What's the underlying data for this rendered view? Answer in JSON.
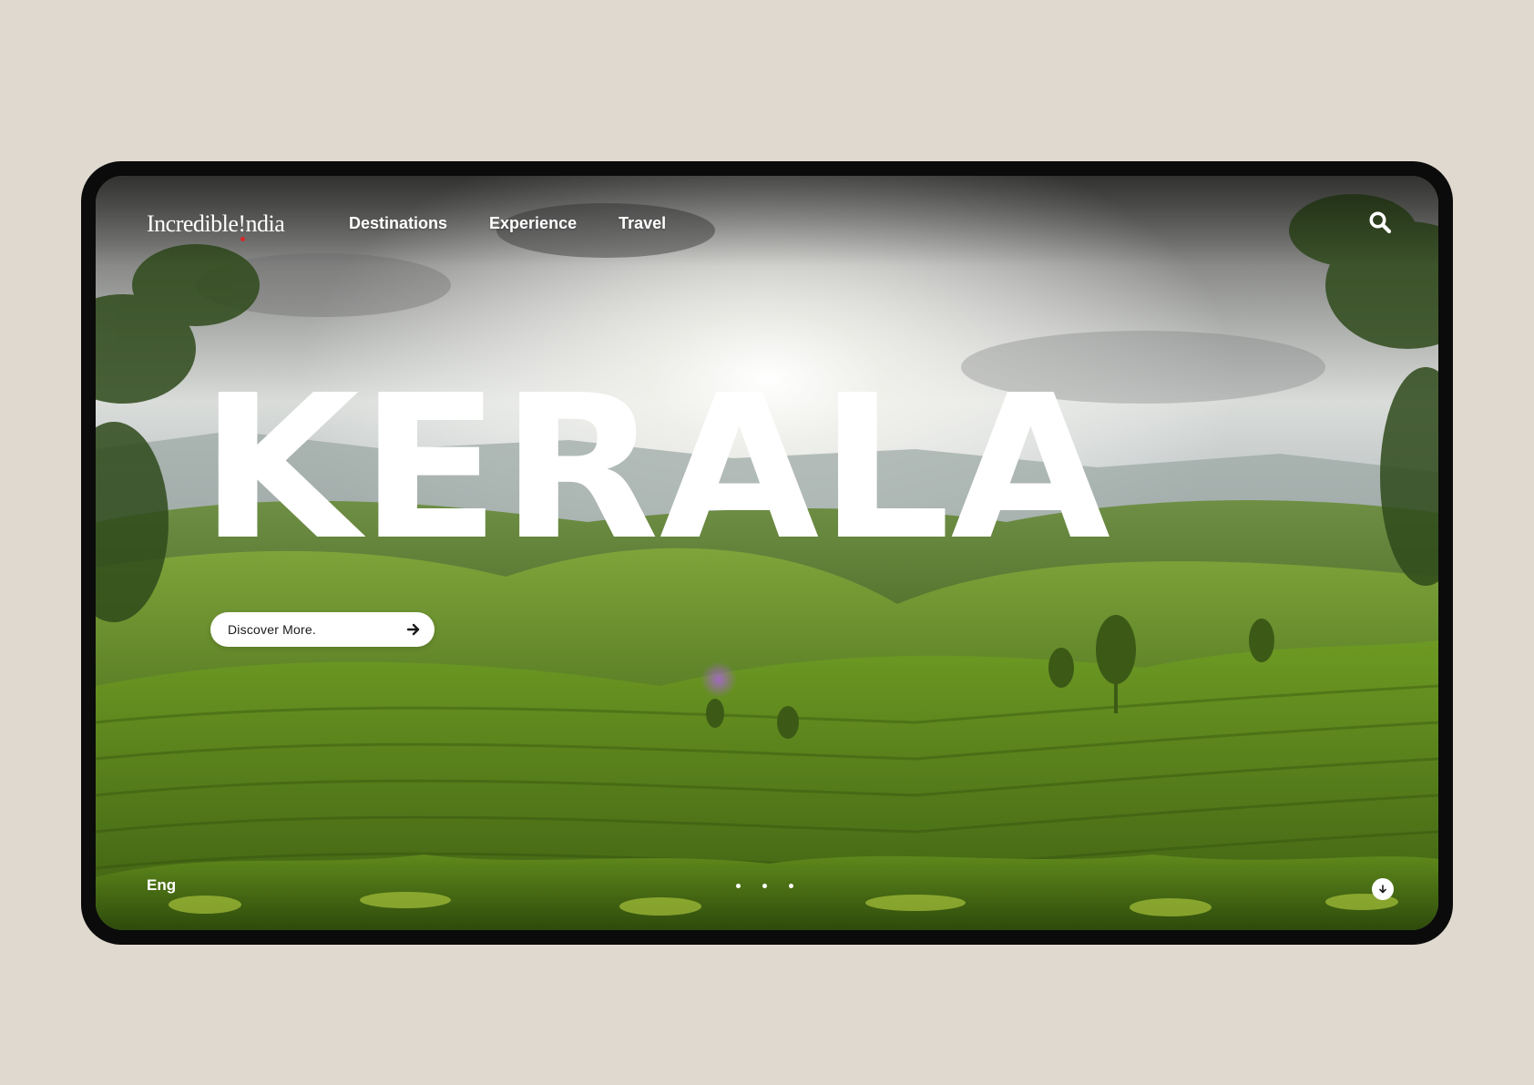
{
  "logo": {
    "text": "Incredible!ndia"
  },
  "nav": {
    "items": [
      {
        "label": "Destinations"
      },
      {
        "label": "Experience"
      },
      {
        "label": "Travel"
      }
    ]
  },
  "hero": {
    "title": "KERALA",
    "cta_label": "Discover More."
  },
  "footer": {
    "language": "Eng",
    "slides_total": 3
  },
  "icons": {
    "search": "search-icon",
    "cta": "arrow-right-icon",
    "scroll": "arrow-down-icon"
  },
  "colors": {
    "page_background": "#e0d9cf",
    "frame": "#0b0b0b",
    "text_on_image": "#ffffff",
    "button_background": "#ffffff",
    "logo_dot": "#d6262a"
  }
}
